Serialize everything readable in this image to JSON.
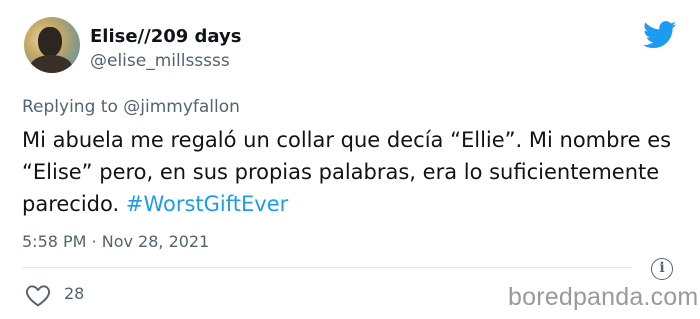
{
  "author": {
    "display_name": "Elise//209 days",
    "handle": "@elise_millsssss"
  },
  "reply": {
    "prefix": "Replying to ",
    "mention": "@jimmyfallon"
  },
  "tweet": {
    "text": "Mi abuela me regaló un collar que decía “Ellie”. Mi nombre es “Elise” pero, en sus propias palabras, era lo suficientemente parecido. ",
    "hashtag": "#WorstGiftEver"
  },
  "meta": {
    "timestamp": "5:58 PM · Nov 28, 2021"
  },
  "engagement": {
    "likes": "28"
  },
  "icons": {
    "brand": "twitter-bird-icon",
    "info": "info-icon",
    "like": "heart-icon"
  },
  "watermark": {
    "text": "boredpanda.com"
  },
  "colors": {
    "twitter_blue": "#1d9bf0",
    "secondary_text": "#536471",
    "primary_text": "#0f1419"
  }
}
